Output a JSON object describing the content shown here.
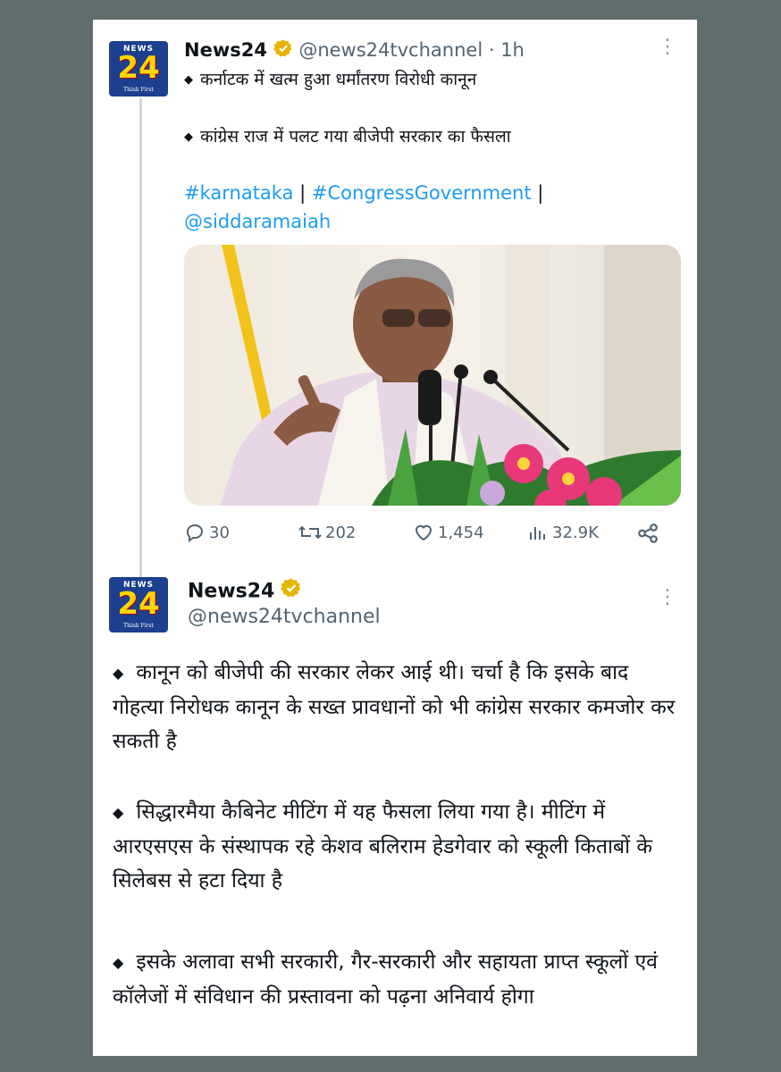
{
  "tweet1": {
    "author_name": "News24",
    "handle": "@news24tvchannel",
    "time": "· 1h",
    "line1": "कर्नाटक में खत्म हुआ धर्मांतरण विरोधी कानून",
    "line2": "कांग्रेस राज में पलट गया बीजेपी सरकार का फैसला",
    "hashtag1": "#karnataka",
    "sep": "|",
    "hashtag2": "#CongressGovernment",
    "mention": "@siddaramaiah",
    "replies": "30",
    "retweets": "202",
    "likes": "1,454",
    "views": "32.9K"
  },
  "tweet2": {
    "author_name": "News24",
    "handle": "@news24tvchannel",
    "para1": "कानून को बीजेपी की सरकार लेकर आई थी। चर्चा है कि इसके बाद गोहत्या निरोधक कानून के सख्त प्रावधानों को भी कांग्रेस सरकार कमजोर कर सकती है",
    "para2": "सिद्धारमैया कैबिनेट मीटिंग में यह फैसला लिया गया है। मीटिंग में आरएसएस के संस्थापक रहे केशव बलिराम हेडगेवार को स्कूली किताबों के सिलेबस से हटा दिया है",
    "para3": "इसके अलावा सभी सरकारी, गैर-सरकारी और सहायता प्राप्त स्कूलों एवं कॉलेजों में संविधान की प्रस्तावना को पढ़ना अनिवार्य होगा"
  },
  "logo": {
    "top": "NEWS",
    "number": "24",
    "tagline": "Think First"
  },
  "bullet": "◆",
  "more_glyph": "⋮",
  "icons": [
    "reply-icon",
    "retweet-icon",
    "like-icon",
    "views-icon",
    "share-icon",
    "verified-icon",
    "more-icon"
  ],
  "colors": {
    "background": "#5f6e6c",
    "link": "#1d9bf0",
    "verified": "#e8b400",
    "muted": "#536471",
    "logo_blue": "#1d3f8f",
    "logo_yellow": "#ffd500"
  }
}
